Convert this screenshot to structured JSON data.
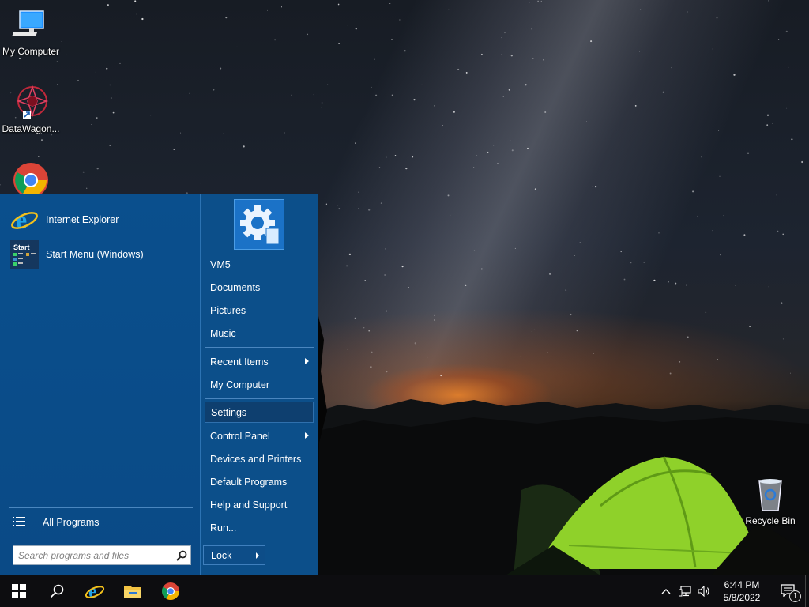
{
  "desktop": {
    "icons": [
      {
        "label": "My Computer"
      },
      {
        "label": "DataWagon..."
      },
      {
        "label": ""
      },
      {
        "label": "Recycle Bin"
      }
    ]
  },
  "start_menu": {
    "programs": [
      {
        "label": "Internet Explorer",
        "icon": "internet-explorer-icon"
      },
      {
        "label": "Start Menu (Windows)",
        "icon": "start-menu-settings-icon"
      }
    ],
    "all_programs": "All Programs",
    "search_placeholder": "Search programs and files",
    "user_picture": "gear-user-icon",
    "right_items": [
      {
        "label": "VM5"
      },
      {
        "label": "Documents"
      },
      {
        "label": "Pictures"
      },
      {
        "label": "Music"
      },
      {
        "label": "Recent Items",
        "submenu": true
      },
      {
        "label": "My Computer"
      },
      {
        "label": "Settings",
        "highlighted": true
      },
      {
        "label": "Control Panel",
        "submenu": true
      },
      {
        "label": "Devices and Printers"
      },
      {
        "label": "Default Programs"
      },
      {
        "label": "Help and Support"
      },
      {
        "label": "Run..."
      }
    ],
    "lock_label": "Lock"
  },
  "taskbar": {
    "pinned": [
      "windows-start-icon",
      "search-icon",
      "internet-explorer-icon",
      "file-explorer-icon",
      "chrome-icon"
    ],
    "tray_icons": [
      "chevron-up-icon",
      "network-icon",
      "volume-icon"
    ],
    "time": "6:44 PM",
    "date": "5/8/2022",
    "notification_count": "1"
  },
  "colors": {
    "start_menu_bg": "#0c4f8a",
    "taskbar_bg": "#0d0d10",
    "tent_green": "#8fd12a"
  }
}
